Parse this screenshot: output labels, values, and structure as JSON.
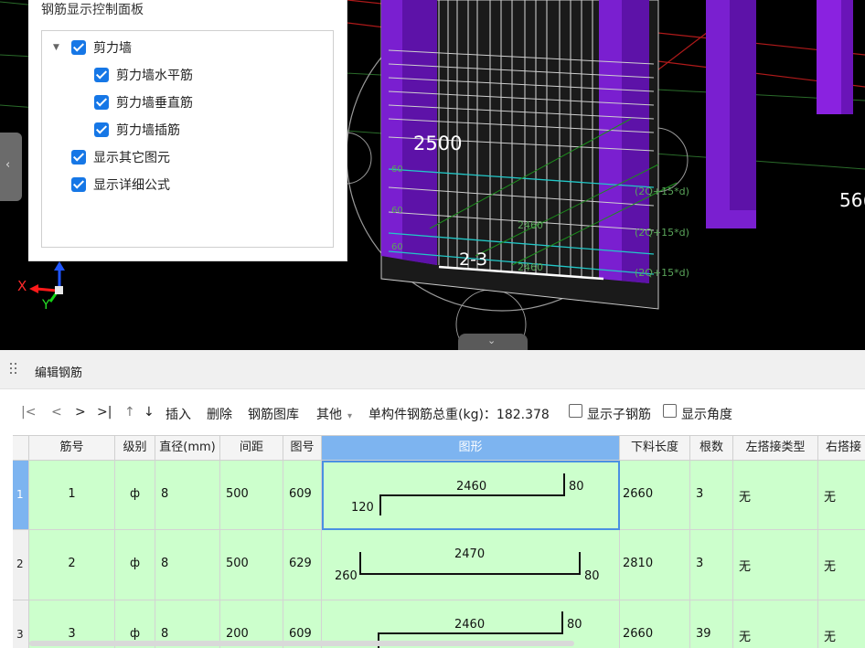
{
  "viewport": {
    "dimension_2500": "2500",
    "dimension_2_3": "2-3",
    "dimension_560": "56(",
    "faint_labels": [
      "2460",
      "2460",
      "60",
      "60",
      "60"
    ],
    "formula_labels": [
      "(2Q+15*d)",
      "(2Q+15*d)",
      "(2Q+15*d)"
    ],
    "axis": {
      "x": "X",
      "y": "Y"
    }
  },
  "panel": {
    "title": "钢筋显示控制面板",
    "tree": [
      {
        "label": "剪力墙",
        "checked": true,
        "level": 0,
        "expanded": true
      },
      {
        "label": "剪力墙水平筋",
        "checked": true,
        "level": 1
      },
      {
        "label": "剪力墙垂直筋",
        "checked": true,
        "level": 1
      },
      {
        "label": "剪力墙插筋",
        "checked": true,
        "level": 1
      },
      {
        "label": "显示其它图元",
        "checked": true,
        "level": 0
      },
      {
        "label": "显示详细公式",
        "checked": true,
        "level": 0
      }
    ]
  },
  "editor": {
    "title": "编辑钢筋",
    "toolbar": {
      "first": "|<",
      "prev": "<",
      "next": ">",
      "last": ">|",
      "up": "↑",
      "down": "↓",
      "insert": "插入",
      "delete": "删除",
      "library": "钢筋图库",
      "other": "其他",
      "weight_label": "单构件钢筋总重(kg)：182.378",
      "show_sub": "显示子钢筋",
      "show_angle": "显示角度"
    },
    "columns": [
      "筋号",
      "级别",
      "直径(mm)",
      "间距",
      "图号",
      "图形",
      "下料长度",
      "根数",
      "左搭接类型",
      "右搭接"
    ],
    "rows": [
      {
        "index": "1",
        "no": "1",
        "grade": "ф",
        "diameter": "8",
        "spacing": "500",
        "shape_no": "609",
        "shape": {
          "left": "120",
          "middle": "2460",
          "right": "80"
        },
        "length": "2660",
        "count": "3",
        "left_lap": "无",
        "right_lap": "无"
      },
      {
        "index": "2",
        "no": "2",
        "grade": "ф",
        "diameter": "8",
        "spacing": "500",
        "shape_no": "629",
        "shape": {
          "left": "260",
          "middle": "2470",
          "right": "80"
        },
        "length": "2810",
        "count": "3",
        "left_lap": "无",
        "right_lap": "无"
      },
      {
        "index": "3",
        "no": "3",
        "grade": "ф",
        "diameter": "8",
        "spacing": "200",
        "shape_no": "609",
        "shape": {
          "left": "",
          "middle": "2460",
          "right": "80"
        },
        "length": "2660",
        "count": "39",
        "left_lap": "无",
        "right_lap": "无"
      }
    ]
  },
  "colors": {
    "selected_header": "#7db4f0",
    "row_fill": "#ccffcc",
    "checkbox": "#1677e6",
    "purple": "#8b1bd6"
  }
}
